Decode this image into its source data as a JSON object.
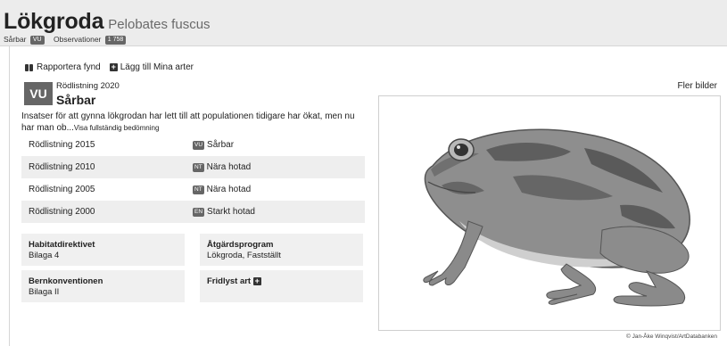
{
  "species": {
    "common_name": "Lökgroda",
    "latin_name": "Pelobates fuscus",
    "status_label": "Sårbar",
    "status_badge": "VU",
    "observations_label": "Observationer",
    "observations_count": "1 758"
  },
  "actions": {
    "report": "Rapportera fynd",
    "add": "Lägg till Mina arter"
  },
  "redlist": {
    "current_code": "VU",
    "current_year": "Rödlistning 2020",
    "current_status": "Sårbar",
    "description": "Insatser för att gynna lökgrodan har lett till att populationen tidigare har ökat, men nu har man ob...",
    "more_link": "Visa fullständig bedömning",
    "history": [
      {
        "year": "Rödlistning 2015",
        "code": "VU",
        "status": "Sårbar"
      },
      {
        "year": "Rödlistning 2010",
        "code": "NT",
        "status": "Nära hotad"
      },
      {
        "year": "Rödlistning 2005",
        "code": "NT",
        "status": "Nära hotad"
      },
      {
        "year": "Rödlistning 2000",
        "code": "EN",
        "status": "Starkt hotad"
      }
    ]
  },
  "cards": {
    "habitat_title": "Habitatdirektivet",
    "habitat_value": "Bilaga 4",
    "program_title": "Åtgärdsprogram",
    "program_value": "Lökgroda, Fastställt",
    "bern_title": "Bernkonventionen",
    "bern_value": "Bilaga II",
    "protected_title": "Fridlyst art"
  },
  "media": {
    "more_images": "Fler bilder",
    "credit": "© Jan-Åke Winqvist/ArtDatabanken"
  },
  "icons": [
    "binoculars-icon",
    "plus-square-icon"
  ],
  "colors": {
    "badge": "#666666",
    "header_bg": "#ececec",
    "row_alt": "#eeeeee"
  }
}
